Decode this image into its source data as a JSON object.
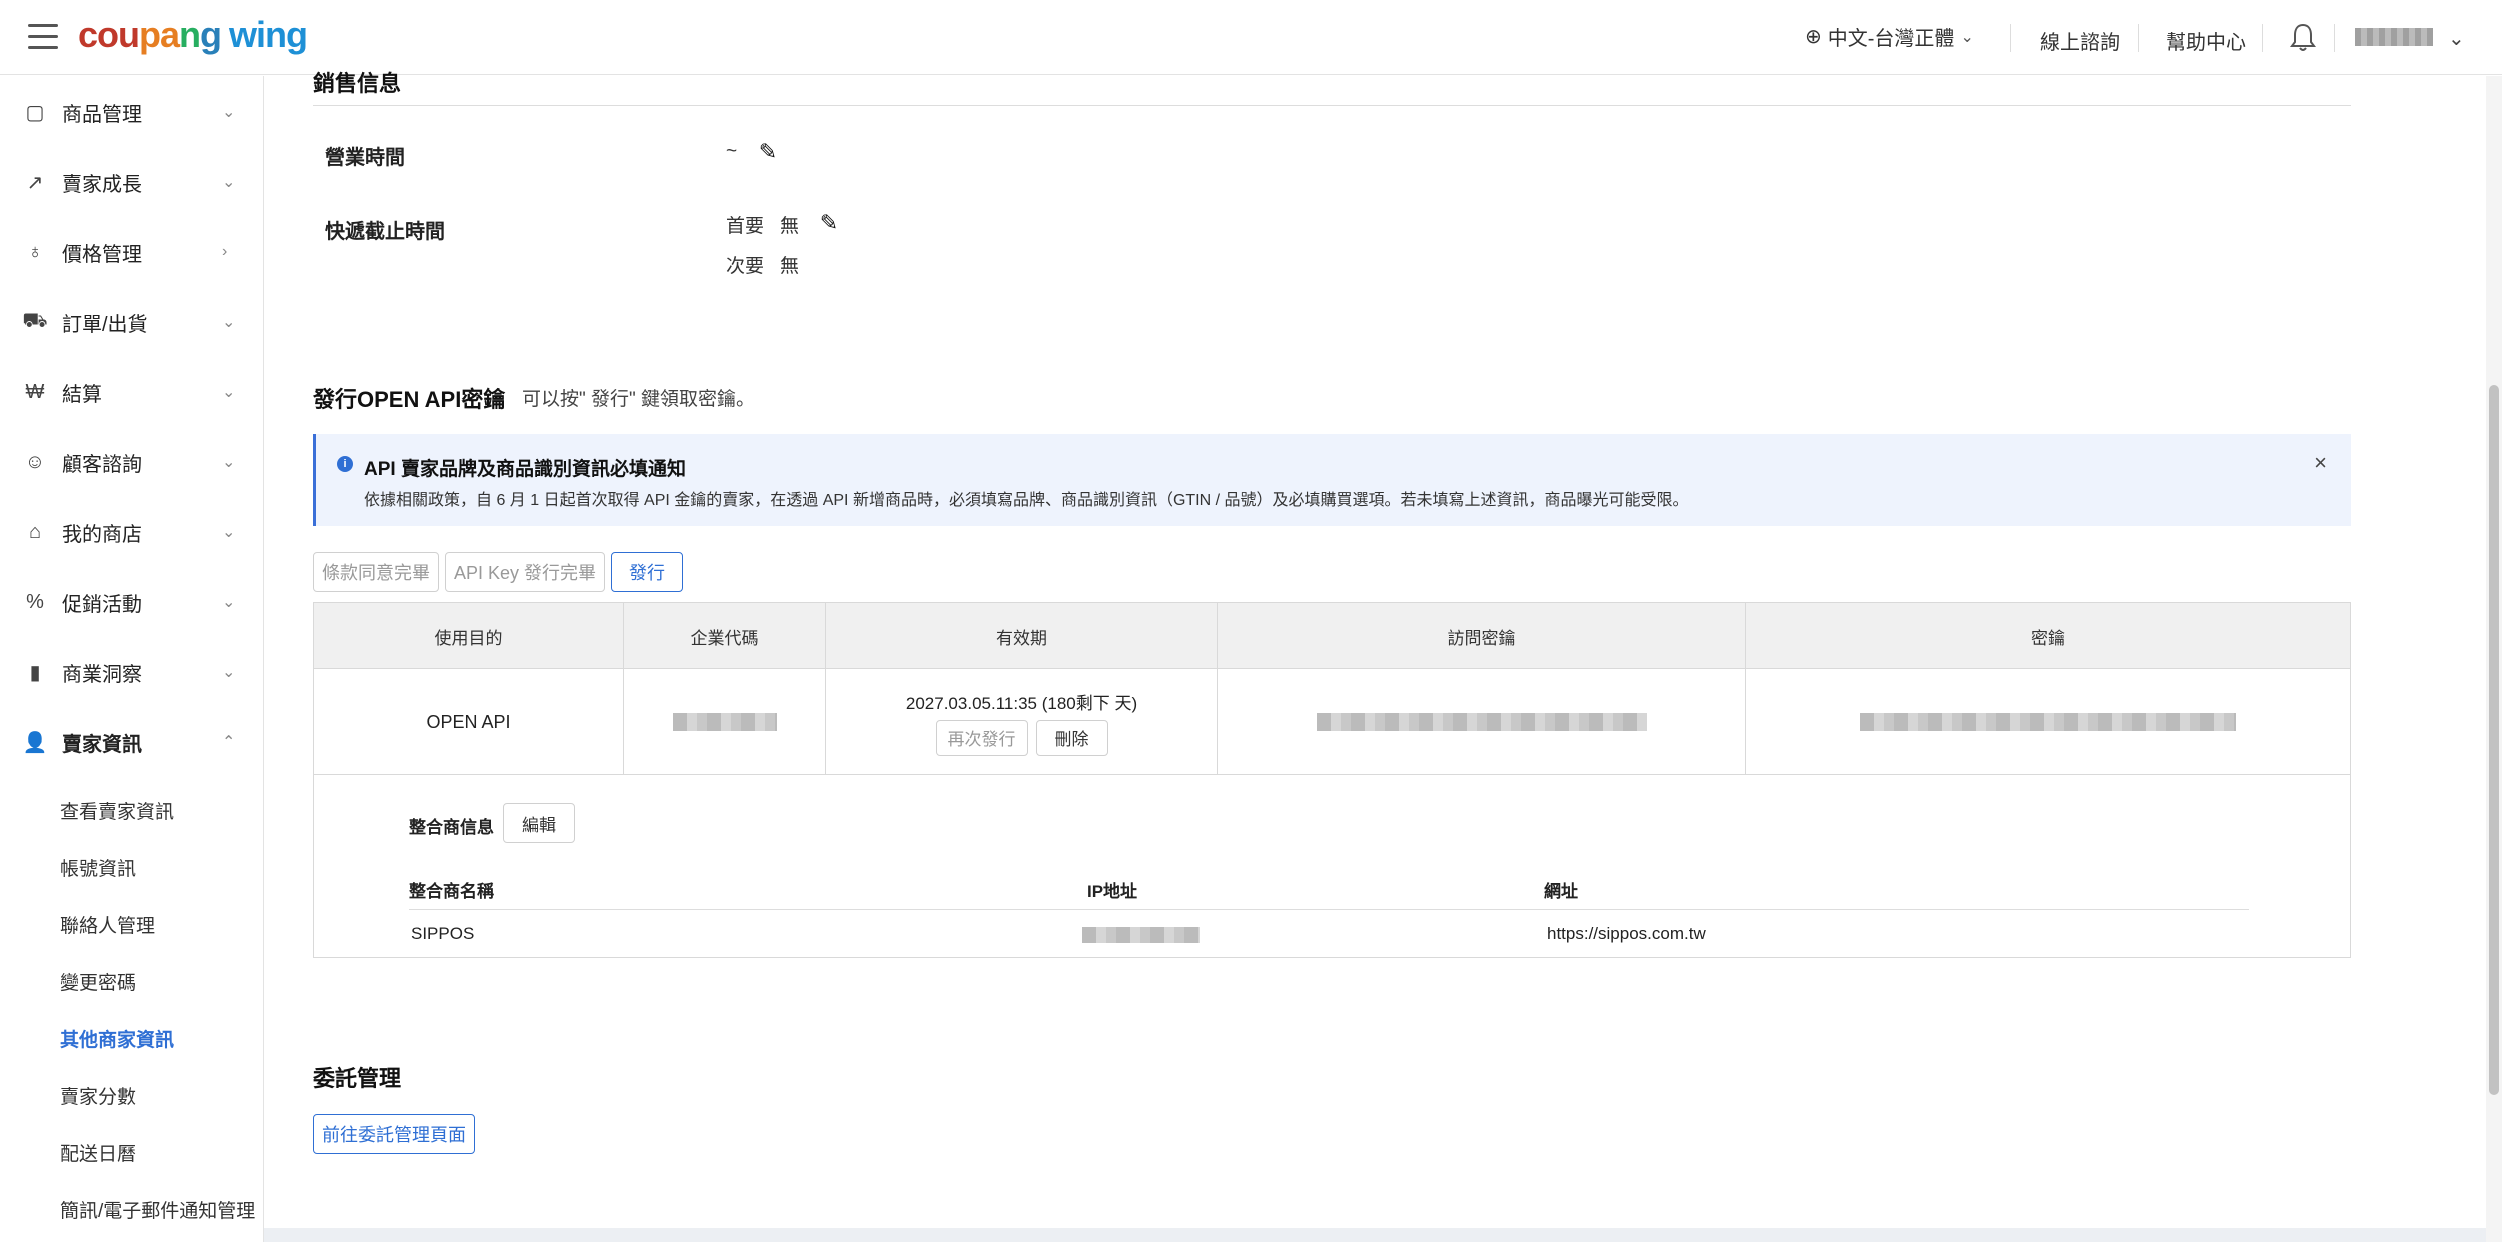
{
  "brand": {
    "part1": "cou",
    "part2": "pa",
    "part3": "n",
    "part4": "g",
    "wing": "wing"
  },
  "topbar": {
    "language": "中文-台灣正體",
    "online_consult": "線上諮詢",
    "help_center": "幫助中心"
  },
  "sidebar": {
    "items": [
      {
        "label": "商品管理"
      },
      {
        "label": "賣家成長"
      },
      {
        "label": "價格管理"
      },
      {
        "label": "訂單/出貨"
      },
      {
        "label": "結算"
      },
      {
        "label": "顧客諮詢"
      },
      {
        "label": "我的商店"
      },
      {
        "label": "促銷活動"
      },
      {
        "label": "商業洞察"
      },
      {
        "label": "賣家資訊"
      }
    ],
    "subitems": [
      {
        "label": "查看賣家資訊"
      },
      {
        "label": "帳號資訊"
      },
      {
        "label": "聯絡人管理"
      },
      {
        "label": "變更密碼"
      },
      {
        "label": "其他商家資訊"
      },
      {
        "label": "賣家分數"
      },
      {
        "label": "配送日曆"
      },
      {
        "label": "簡訊/電子郵件通知管理"
      }
    ]
  },
  "sales": {
    "title": "銷售信息",
    "business_hours_label": "營業時間",
    "business_hours_value": "~",
    "cutoff_label": "快遞截止時間",
    "first_label": "首要",
    "first_value": "無",
    "second_label": "次要",
    "second_value": "無"
  },
  "api": {
    "title": "發行OPEN API密鑰",
    "hint": "可以按\" 發行\" 鍵領取密鑰。",
    "notice_title": "API 賣家品牌及商品識別資訊必填通知",
    "notice_body": "依據相關政策，自 6 月 1 日起首次取得 API 金鑰的賣家，在透過 API 新增商品時，必須填寫品牌、商品識別資訊（GTIN / 品號）及必填購買選項。若未填寫上述資訊，商品曝光可能受限。",
    "step1": "條款同意完畢",
    "step2": "API Key 發行完畢",
    "issue_button": "發行",
    "columns": [
      "使用目的",
      "企業代碼",
      "有效期",
      "訪問密鑰",
      "密鑰"
    ],
    "row": {
      "purpose": "OPEN API",
      "validity": "2027.03.05.11:35 (180剩下 天)",
      "reissue_button": "再次發行",
      "delete_button": "刪除"
    },
    "integrator_label": "整合商信息",
    "edit_button": "編輯",
    "integ_columns": [
      "整合商名稱",
      "IP地址",
      "網址"
    ],
    "integ_row": {
      "name": "SIPPOS",
      "url": "https://sippos.com.tw"
    }
  },
  "delegation": {
    "title": "委託管理",
    "button": "前往委託管理頁面"
  }
}
